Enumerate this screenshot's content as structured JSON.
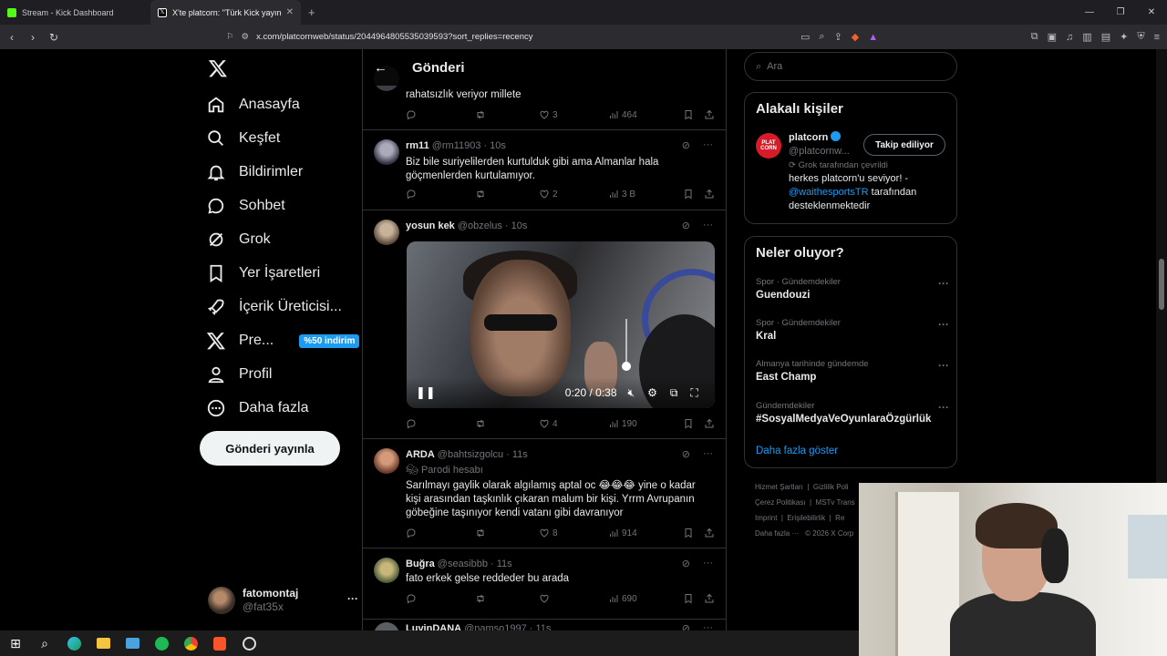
{
  "browser": {
    "tabs": [
      {
        "title": "Stream - Kick Dashboard",
        "favicon_color": "#53fc18"
      },
      {
        "title": "X'te platcorn: \"Türk Kick yayıncıs",
        "favicon_color": "#000000"
      }
    ],
    "url": "x.com/platcornweb/status/2044964805535039593?sort_replies=recency"
  },
  "nav": {
    "items": [
      {
        "label": "Anasayfa",
        "icon": "home-icon"
      },
      {
        "label": "Keşfet",
        "icon": "search-icon"
      },
      {
        "label": "Bildirimler",
        "icon": "bell-icon"
      },
      {
        "label": "Sohbet",
        "icon": "chat-icon"
      },
      {
        "label": "Grok",
        "icon": "grok-icon"
      },
      {
        "label": "Yer İşaretleri",
        "icon": "bookmark-icon"
      },
      {
        "label": "İçerik Üreticisi...",
        "icon": "rocket-icon"
      },
      {
        "label": "Pre...",
        "icon": "x-premium-icon",
        "badge": "%50 indirim"
      },
      {
        "label": "Profil",
        "icon": "person-icon"
      },
      {
        "label": "Daha fazla",
        "icon": "more-circle-icon"
      }
    ],
    "post_button": "Gönderi yayınla",
    "account": {
      "name": "fatomontaj",
      "handle": "@fat35x"
    }
  },
  "center": {
    "title": "Gönderi",
    "tweets": [
      {
        "id": "t0",
        "text_partial": "rahatsızlık veriyor millete",
        "stats": {
          "replies": "",
          "retweets": "",
          "likes": "3",
          "views": "464"
        }
      },
      {
        "id": "t1",
        "name": "rm11",
        "handle": "@rm11903",
        "time": "· 10s",
        "text": "Biz bile suriyelilerden kurtulduk gibi ama Almanlar hala göçmenlerden kurtulamıyor.",
        "stats": {
          "replies": "",
          "retweets": "",
          "likes": "2",
          "views": "3 B"
        }
      },
      {
        "id": "t2",
        "name": "yosun kek",
        "handle": "@obzelus",
        "time": "· 10s",
        "video": {
          "time": "0:20 / 0:38",
          "state": "playing",
          "muted": true
        },
        "stats": {
          "replies": "",
          "retweets": "",
          "likes": "4",
          "views": "190"
        }
      },
      {
        "id": "t3",
        "name": "ARDA",
        "handle": "@bahtsizgolcu",
        "time": "· 11s",
        "sublabel": "Parodi hesabı",
        "text": "Sarılmayı gaylik olarak algılamış aptal oc 😂😂😂 yine o kadar kişi arasından taşkınlık çıkaran malum bir kişi. Yrrm Avrupanın göbeğine taşınıyor kendi vatanı gibi davranıyor",
        "stats": {
          "replies": "",
          "retweets": "",
          "likes": "8",
          "views": "914"
        }
      },
      {
        "id": "t4",
        "name": "Buğra",
        "handle": "@seasibbb",
        "time": "· 11s",
        "text": "fato erkek gelse reddeder bu arada",
        "stats": {
          "replies": "",
          "retweets": "",
          "likes": "",
          "views": "690"
        }
      },
      {
        "id": "t5",
        "name": "LuvinDANA",
        "handle": "@namso1997",
        "time": "· 11s"
      }
    ]
  },
  "right": {
    "search_placeholder": "Ara",
    "related": {
      "title": "Alakalı kişiler",
      "name": "platcorn",
      "handle": "@platcornw...",
      "follow_label": "Takip ediliyor",
      "translated_note": "Grok tarafından çevrildi",
      "bio_1": "herkes platcorn'u seviyor! -",
      "bio_mention": "@waithesportsTR",
      "bio_2": "tarafından desteklenmektedir",
      "avatar_text": "PLAT CORN"
    },
    "trends": {
      "title": "Neler oluyor?",
      "items": [
        {
          "category": "Spor · Gündemdekiler",
          "name": "Guendouzi"
        },
        {
          "category": "Spor · Gündemdekiler",
          "name": "Kral"
        },
        {
          "category": "Almanya tarihinde gündemde",
          "name": "East Champ"
        },
        {
          "category": "Gündemdekiler",
          "name": "#SosyalMedyaVeOyunlaraÖzgürlük"
        }
      ],
      "show_more": "Daha fazla göster"
    },
    "footer": [
      [
        "Hizmet Şartları",
        "Gizlilik Poli"
      ],
      [
        "Çerez Politikası",
        "MSTv Trans"
      ],
      [
        "Imprint",
        "Erişilebilirlik",
        "Re"
      ],
      [
        "Daha fazla ···",
        "© 2026 X Corp"
      ]
    ]
  },
  "colors": {
    "accent": "#1d9bf0",
    "background": "#000000",
    "border": "#2f3336",
    "muted": "#71767b"
  }
}
